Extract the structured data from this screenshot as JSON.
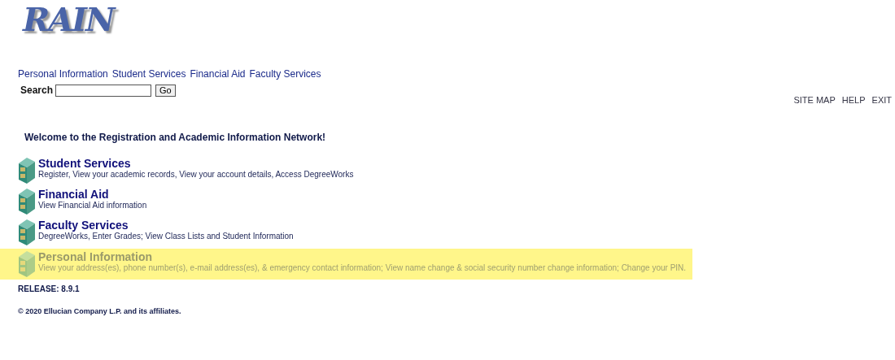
{
  "logo": {
    "text": "RAIN"
  },
  "nav_links": [
    "Personal Information",
    "Student Services",
    "Financial Aid",
    "Faculty Services"
  ],
  "search": {
    "label": "Search",
    "button": "Go"
  },
  "utility_links": [
    "SITE MAP",
    "HELP",
    "EXIT"
  ],
  "welcome": "Welcome to the Registration and Academic Information Network!",
  "menu": [
    {
      "title": "Student Services",
      "description": "Register, View your academic records, View your account details, Access DegreeWorks",
      "highlighted": false
    },
    {
      "title": "Financial Aid",
      "description": "View Financial Aid information",
      "highlighted": false
    },
    {
      "title": "Faculty Services",
      "description": "DegreeWorks, Enter Grades; View Class Lists and Student Information",
      "highlighted": false
    },
    {
      "title": "Personal Information",
      "description": "View your address(es), phone number(s), e-mail address(es), & emergency contact information; View name change & social security number change information; Change your PIN.",
      "highlighted": true
    }
  ],
  "release": "RELEASE: 8.9.1",
  "copyright": "© 2020 Ellucian Company L.P. and its affiliates."
}
